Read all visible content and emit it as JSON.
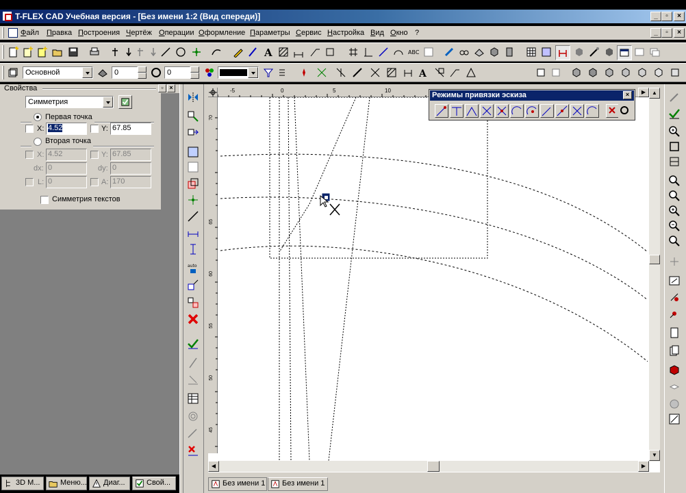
{
  "window": {
    "title": "T-FLEX CAD Учебная версия - [Без имени 1:2 (Вид спереди)]"
  },
  "menu": [
    "Файл",
    "Правка",
    "Построения",
    "Чертёж",
    "Операции",
    "Оформление",
    "Параметры",
    "Сервис",
    "Настройка",
    "Вид",
    "Окно",
    "?"
  ],
  "toolbar2": {
    "layer_combo": "Основной",
    "level_value": "0",
    "priority_value": "0"
  },
  "properties": {
    "header": "Свойства",
    "command_combo": "Симметрия",
    "first_point_label": "Первая точка",
    "second_point_label": "Вторая точка",
    "first_x_label": "X:",
    "first_x_value": "4.52",
    "first_y_label": "Y:",
    "first_y_value": "67.85",
    "second_x_label": "X:",
    "second_x_value": "4.52",
    "second_y_label": "Y:",
    "second_y_value": "67.85",
    "dx_label": "dx:",
    "dx_value": "0",
    "dy_label": "dy:",
    "dy_value": "0",
    "l_label": "L:",
    "l_value": "0",
    "a_label": "A:",
    "a_value": "170",
    "symmetry_texts_label": "Симметрия текстов"
  },
  "bottom_tabs": [
    "3D М...",
    "Меню...",
    "Диаг...",
    "Свой..."
  ],
  "snap_panel": {
    "title": "Режимы привязки эскиза"
  },
  "ruler": {
    "h_ticks": [
      "-5",
      "0",
      "5",
      "10"
    ],
    "v_ticks": [
      "70",
      "65",
      "60",
      "55",
      "50",
      "45"
    ]
  },
  "doc_tabs": [
    "Без имени 1",
    "Без имени 1"
  ],
  "colors": {
    "title_start": "#0a246a",
    "title_end": "#a6caf0",
    "face": "#d4d0c8",
    "workspace": "#808080"
  }
}
